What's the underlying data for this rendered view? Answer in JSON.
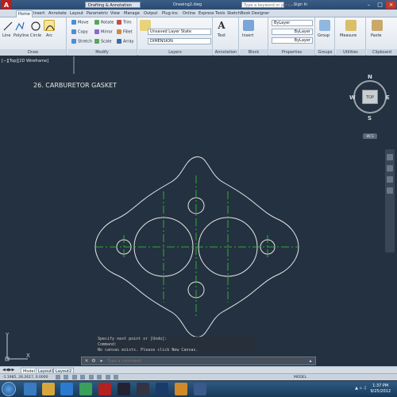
{
  "titlebar": {
    "app_button": "A",
    "workspace": "Drafting & Annotation",
    "document": "Drawing2.dwg",
    "search_placeholder": "Type a keyword or phrase",
    "signin": "Sign In"
  },
  "tabs": [
    "Home",
    "Insert",
    "Annotate",
    "Layout",
    "Parametric",
    "View",
    "Manage",
    "Output",
    "Plug-ins",
    "Online",
    "Express Tools",
    "SketchBook Designer"
  ],
  "ribbon": {
    "draw": {
      "title": "Draw",
      "tools": [
        "Line",
        "Polyline",
        "Circle",
        "Arc"
      ]
    },
    "modify": {
      "title": "Modify",
      "tools": [
        "Move",
        "Rotate",
        "Trim",
        "Copy",
        "Mirror",
        "Fillet",
        "Stretch",
        "Scale",
        "Array"
      ]
    },
    "layers": {
      "title": "Layers",
      "layer_state": "Unsaved Layer State",
      "current_layer": "DIMENSION"
    },
    "annotation": {
      "title": "Annotation",
      "text_label": "Text"
    },
    "block": {
      "title": "Block",
      "insert_label": "Insert"
    },
    "properties": {
      "title": "Properties",
      "color": "ByLayer",
      "linetype": "ByLayer",
      "lineweight": "ByLayer"
    },
    "groups": {
      "title": "Groups",
      "group_label": "Group"
    },
    "utilities": {
      "title": "Utilities",
      "measure_label": "Measure"
    },
    "clipboard": {
      "title": "Clipboard",
      "paste_label": "Paste"
    }
  },
  "viewport": {
    "label": "[−][Top][2D Wireframe]",
    "drawing_title": "26. CARBURETOR GASKET"
  },
  "viewcube": {
    "n": "N",
    "s": "S",
    "e": "E",
    "w": "W",
    "top": "TOP",
    "wcs": "WCS"
  },
  "ucs": {
    "x": "X",
    "y": "Y"
  },
  "command": {
    "history": [
      "Specify next point or [Undo]:",
      "Command:",
      "No canvas exists. Please click New Canvas."
    ],
    "placeholder": "Type a command"
  },
  "layout_tabs": [
    "Model",
    "Layout1",
    "Layout2"
  ],
  "statusbar": {
    "coords": "-1.1985, 26.2617, 0.0000",
    "model": "MODEL"
  },
  "taskbar": {
    "time": "1:37 PM",
    "date": "9/25/2012"
  },
  "colors": {
    "canvas": "#243140",
    "geometry": "#e6e6e6",
    "centerline": "#2fd12f",
    "accent": "#3a5d86"
  }
}
